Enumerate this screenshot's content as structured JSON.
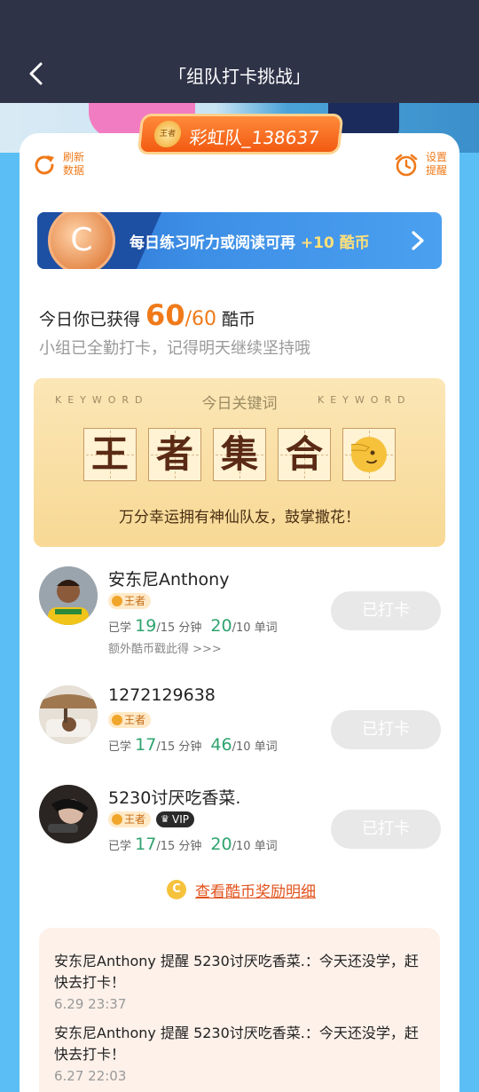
{
  "header": {
    "title": "「组队打卡挑战」"
  },
  "team": {
    "badge": "王者",
    "name": "彩虹队_138637"
  },
  "toolbar": {
    "refresh": [
      "刷新",
      "数据"
    ],
    "remind": [
      "设置",
      "提醒"
    ]
  },
  "promo": {
    "coin_glyph": "C",
    "prefix": "每日练习听力或阅读可再 ",
    "reward": "+10 酷币"
  },
  "earned": {
    "label": "今日你已获得 ",
    "value": "60",
    "max": "/60",
    "unit": "酷币",
    "subtitle": "小组已全勤打卡，记得明天继续坚持哦"
  },
  "keyword": {
    "left_label": "KEYWORD",
    "right_label": "KEYWORD",
    "title": "今日关键词",
    "chars": [
      "王",
      "者",
      "集",
      "合"
    ],
    "motto": "万分幸运拥有神仙队友，鼓掌撒花！"
  },
  "members": [
    {
      "name": "安东尼Anthony",
      "badge": "王者",
      "vip": "",
      "studied_prefix": "已学 ",
      "minutes": "19",
      "minutes_goal": "/15 分钟",
      "words": "20",
      "words_goal": "/10 单词",
      "extra": "额外酷币戳此得 >>>",
      "button": "已打卡"
    },
    {
      "name": "1272129638",
      "badge": "王者",
      "vip": "",
      "studied_prefix": "已学 ",
      "minutes": "17",
      "minutes_goal": "/15 分钟",
      "words": "46",
      "words_goal": "/10 单词",
      "extra": "",
      "button": "已打卡"
    },
    {
      "name": "5230讨厌吃香菜.",
      "badge": "王者",
      "vip": "VIP",
      "studied_prefix": "已学 ",
      "minutes": "17",
      "minutes_goal": "/15 分钟",
      "words": "20",
      "words_goal": "/10 单词",
      "extra": "",
      "button": "已打卡"
    }
  ],
  "reward_link": {
    "coin_glyph": "C",
    "label": "查看酷币奖励明细"
  },
  "messages": [
    {
      "text": "安东尼Anthony 提醒 5230讨厌吃香菜.：今天还没学，赶快去打卡！",
      "time": "6.29 23:37"
    },
    {
      "text": "安东尼Anthony 提醒 5230讨厌吃香菜.：今天还没学，赶快去打卡！",
      "time": "6.27 22:03"
    }
  ],
  "colors": {
    "accent": "#f07a1a",
    "header": "#2f3348",
    "background": "#5bbff5",
    "green": "#2fa36f"
  }
}
